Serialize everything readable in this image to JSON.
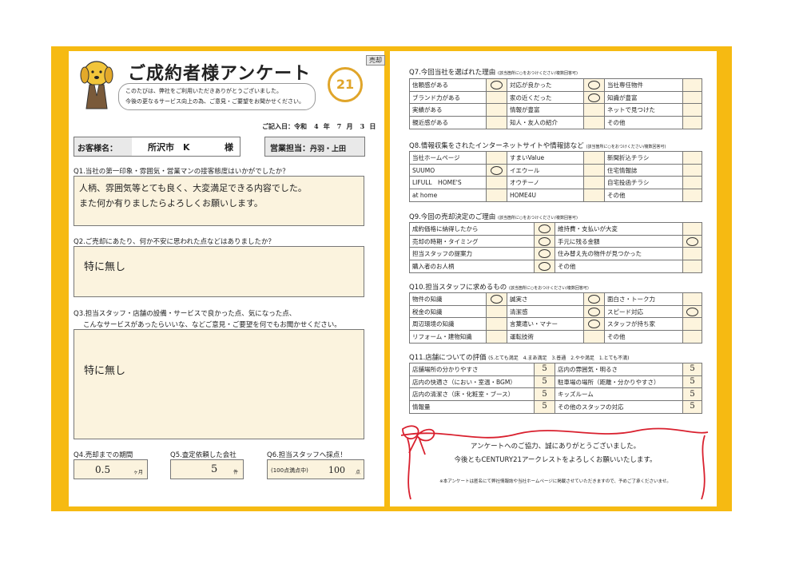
{
  "header": {
    "title": "ご成約者様アンケート",
    "tag": "売却",
    "logo": "21",
    "bubble_line1": "このたびは、弊社をご利用いただきありがとうございました。",
    "bubble_line2": "今後の更なるサービス向上の為、ご意見・ご要望をお聞かせください。",
    "date_label": "ご記入日：令和",
    "date_year": "4",
    "date_year_unit": "年",
    "date_month": "7",
    "date_month_unit": "月",
    "date_day": "3",
    "date_day_unit": "日"
  },
  "customer": {
    "label": "お客様名：",
    "name": "所沢市　K",
    "honorific": "様",
    "staff_label": "営業担当：",
    "staff_name": "丹羽・上田"
  },
  "q1": {
    "question": "Q1.当社の第一印象・雰囲気・営業マンの接客態度はいかがでしたか？",
    "answer_line1": "人柄、雰囲気等とても良く、大変満足できる内容でした。",
    "answer_line2": "また何か有りましたらよろしくお願いします。"
  },
  "q2": {
    "question": "Q2.ご売却にあたり、何か不安に思われた点などはありましたか？",
    "answer": "特に無し"
  },
  "q3": {
    "question_line1": "Q3.担当スタッフ・店舗の設備・サービスで良かった点、気になった点、",
    "question_line2": "こんなサービスがあったらいいな、などご意見・ご要望を何でもお聞かせください。",
    "answer": "特に無し"
  },
  "q4": {
    "question": "Q4.売却までの期間",
    "value": "0.5",
    "unit": "ヶ月"
  },
  "q5": {
    "question": "Q5.査定依頼した会社",
    "value": "5",
    "unit": "件"
  },
  "q6": {
    "question": "Q6.担当スタッフへ採点！",
    "sub": "(100点満点中)",
    "value": "100",
    "unit": "点"
  },
  "q7": {
    "title": "Q7.今回当社を選ばれた理由",
    "note": "(該当箇所に○をおつけください/複数回答可)",
    "rows": [
      [
        {
          "t": "信頼感がある",
          "m": true
        },
        {
          "t": "対応が良かった",
          "m": true
        },
        {
          "t": "当社専任物件",
          "m": false
        }
      ],
      [
        {
          "t": "ブランド力がある",
          "m": false
        },
        {
          "t": "家の近くだった",
          "m": true
        },
        {
          "t": "知識が豊富",
          "m": false
        }
      ],
      [
        {
          "t": "実績がある",
          "m": false
        },
        {
          "t": "情報が豊富",
          "m": false
        },
        {
          "t": "ネットで見つけた",
          "m": false
        }
      ],
      [
        {
          "t": "親近感がある",
          "m": false
        },
        {
          "t": "知人・友人の紹介",
          "m": false
        },
        {
          "t": "その他",
          "m": false
        }
      ]
    ]
  },
  "q8": {
    "title": "Q8.情報収集をされたインターネットサイトや情報誌など",
    "note": "(該当箇所に○をおつけください/複数回答可)",
    "rows": [
      [
        {
          "t": "当社ホームページ",
          "m": false
        },
        {
          "t": "すまいValue",
          "m": false
        },
        {
          "t": "新聞折込チラシ",
          "m": false
        }
      ],
      [
        {
          "t": "SUUMO",
          "m": true
        },
        {
          "t": "イエウール",
          "m": false
        },
        {
          "t": "住宅情報誌",
          "m": false
        }
      ],
      [
        {
          "t": "LIFULL　HOME'S",
          "m": false
        },
        {
          "t": "オウチーノ",
          "m": false
        },
        {
          "t": "自宅投函チラシ",
          "m": false
        }
      ],
      [
        {
          "t": "at home",
          "m": false
        },
        {
          "t": "HOME4U",
          "m": false
        },
        {
          "t": "その他",
          "m": false
        }
      ]
    ]
  },
  "q9": {
    "title": "Q9.今回の売却決定のご理由",
    "note": "(該当箇所に○をおつけください/複数回答可)",
    "rows": [
      [
        {
          "t": "成約価格に納得したから",
          "m": true
        },
        {
          "t": "維持費・支払いが大変",
          "m": false
        }
      ],
      [
        {
          "t": "売却の時期・タイミング",
          "m": true
        },
        {
          "t": "手元に残る金額",
          "m": true
        }
      ],
      [
        {
          "t": "担当スタッフの提案力",
          "m": true
        },
        {
          "t": "住み替え先の物件が見つかった",
          "m": false
        }
      ],
      [
        {
          "t": "購入者のお人柄",
          "m": true
        },
        {
          "t": "その他",
          "m": false
        }
      ]
    ]
  },
  "q10": {
    "title": "Q10.担当スタッフに求めるもの",
    "note": "(該当箇所に○をおつけください/複数回答可)",
    "rows": [
      [
        {
          "t": "物件の知識",
          "m": true
        },
        {
          "t": "誠実さ",
          "m": true
        },
        {
          "t": "面白さ・トーク力",
          "m": false
        }
      ],
      [
        {
          "t": "税金の知識",
          "m": false
        },
        {
          "t": "清潔感",
          "m": true
        },
        {
          "t": "スピード対応",
          "m": true
        }
      ],
      [
        {
          "t": "周辺環境の知識",
          "m": false
        },
        {
          "t": "言葉遣い・マナー",
          "m": true
        },
        {
          "t": "スタッフが持ち家",
          "m": false
        }
      ],
      [
        {
          "t": "リフォーム・建物知識",
          "m": false
        },
        {
          "t": "運転技術",
          "m": false
        },
        {
          "t": "その他",
          "m": false
        }
      ]
    ]
  },
  "q11": {
    "title": "Q11.店舗についての評価",
    "scale": "(5.とても満足　4.まあ満足　3.普通　2.やや満足　1.とても不満)",
    "rows": [
      [
        {
          "t": "店舗場所の分かりやすさ",
          "v": "5"
        },
        {
          "t": "店内の雰囲気・明るさ",
          "v": "5"
        }
      ],
      [
        {
          "t": "店内の快適さ（におい・室温・BGM）",
          "v": "5"
        },
        {
          "t": "駐車場の場所（距離・分かりやすさ）",
          "v": "5"
        }
      ],
      [
        {
          "t": "店内の清潔さ（床・化粧室・ブース）",
          "v": "5"
        },
        {
          "t": "キッズルーム",
          "v": "5"
        }
      ],
      [
        {
          "t": "情報量",
          "v": "5"
        },
        {
          "t": "その他のスタッフの対応",
          "v": "5"
        }
      ]
    ]
  },
  "footer": {
    "thanks1": "アンケートへのご協力、誠にありがとうございました。",
    "thanks2": "今後ともCENTURY21アークレストをよろしくお願いいたします。",
    "note": "※本アンケートは匿名にて弊社情報誌や当社ホームページに掲載させていただきますので、予めご了承くださいませ。"
  },
  "colors": {
    "frame": "#f6ba12",
    "answer_fill": "#fbf3de",
    "ribbon": "#d9202e",
    "logo": "#e0a52a"
  }
}
